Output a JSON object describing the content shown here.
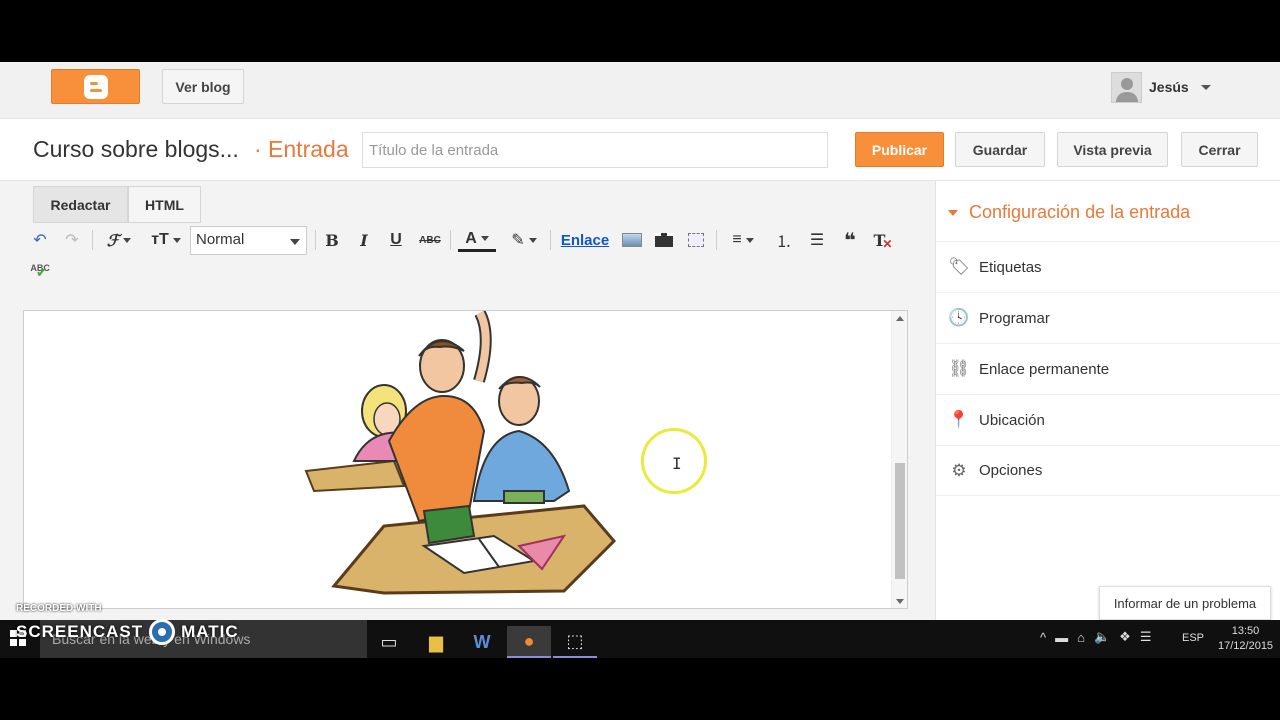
{
  "topbar": {
    "ver_blog": "Ver blog",
    "user_name": "Jesús"
  },
  "post": {
    "blog_name": "Curso sobre blogs...",
    "section": "· Entrada",
    "title_placeholder": "Título de la entrada",
    "buttons": {
      "publicar": "Publicar",
      "guardar": "Guardar",
      "vista_previa": "Vista previa",
      "cerrar": "Cerrar"
    }
  },
  "editor": {
    "modes": {
      "redactar": "Redactar",
      "html": "HTML"
    },
    "font_size": "Normal",
    "link_label": "Enlace",
    "text_color": "#222222"
  },
  "sidebar": {
    "title": "Configuración de la entrada",
    "items": [
      {
        "label": "Etiquetas",
        "icon": "tag-icon"
      },
      {
        "label": "Programar",
        "icon": "clock-icon"
      },
      {
        "label": "Enlace permanente",
        "icon": "link-icon"
      },
      {
        "label": "Ubicación",
        "icon": "location-pin-icon"
      },
      {
        "label": "Opciones",
        "icon": "gear-icon"
      }
    ],
    "report": "Informar de un problema"
  },
  "taskbar": {
    "search_placeholder": "Buscar en la web y en Windows",
    "lang": "ESP",
    "time": "13:50",
    "date": "17/12/2015"
  },
  "watermark": {
    "recorded": "RECORDED WITH",
    "brand_left": "SCREENCAST",
    "brand_right": "MATIC"
  },
  "colors": {
    "accent": "#f8903b",
    "section": "#e8793a",
    "link": "#1155cc"
  }
}
